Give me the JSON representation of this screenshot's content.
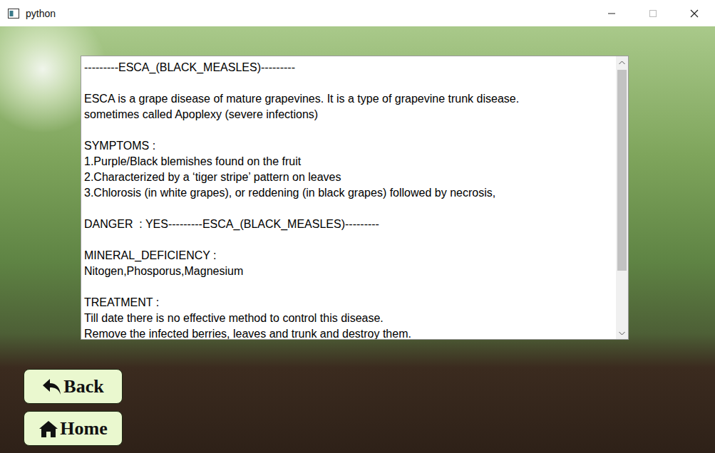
{
  "window": {
    "title": "python"
  },
  "info": {
    "lines": [
      "---------ESCA_(BLACK_MEASLES)---------",
      "",
      "ESCA is a grape disease of mature grapevines. It is a type of grapevine trunk disease.",
      "sometimes called Apoplexy (severe infections)",
      "",
      "SYMPTOMS :",
      "1.Purple/Black blemishes found on the fruit",
      "2.Characterized by a ‘tiger stripe’ pattern on leaves",
      "3.Chlorosis (in white grapes), or reddening (in black grapes) followed by necrosis,",
      "",
      "DANGER  : YES---------ESCA_(BLACK_MEASLES)---------",
      "",
      "MINERAL_DEFICIENCY :",
      "Nitogen,Phosporus,Magnesium",
      "",
      "TREATMENT :",
      "Till date there is no effective method to control this disease.",
      "Remove the infected berries, leaves and trunk and destroy them."
    ],
    "scrollbar": {
      "level": 0.78
    }
  },
  "buttons": [
    {
      "label": "Back",
      "kind": "back"
    },
    {
      "label": "Home",
      "kind": "home"
    }
  ]
}
